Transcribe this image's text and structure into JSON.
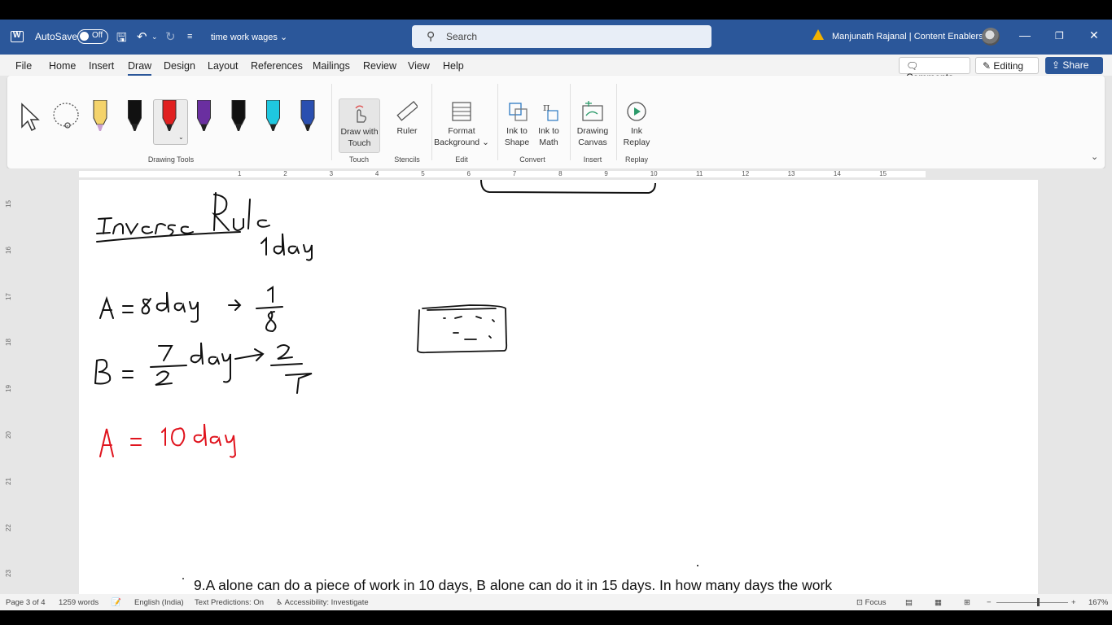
{
  "titlebar": {
    "autosave_label": "AutoSave",
    "autosave_state": "Off",
    "doc_title": "time work wages",
    "search_placeholder": "Search",
    "user_name": "Manjunath Rajanal | Content Enablers"
  },
  "tabs": [
    "File",
    "Home",
    "Insert",
    "Draw",
    "Design",
    "Layout",
    "References",
    "Mailings",
    "Review",
    "View",
    "Help"
  ],
  "active_tab": "Draw",
  "actions": {
    "comments": "Comments",
    "editing": "Editing",
    "share": "Share"
  },
  "ribbon": {
    "groups": {
      "drawing_tools": "Drawing Tools",
      "touch": "Touch",
      "stencils": "Stencils",
      "edit": "Edit",
      "convert": "Convert",
      "insert": "Insert",
      "replay": "Replay"
    },
    "buttons": {
      "draw_with_touch": [
        "Draw with",
        "Touch"
      ],
      "ruler": "Ruler",
      "format_background": [
        "Format",
        "Background"
      ],
      "ink_to_shape": [
        "Ink to",
        "Shape"
      ],
      "ink_to_math": [
        "Ink to",
        "Math"
      ],
      "drawing_canvas": [
        "Drawing",
        "Canvas"
      ],
      "ink_replay": [
        "Ink",
        "Replay"
      ]
    },
    "pen_colors": [
      "#f4d36b",
      "#111111",
      "#e02020",
      "#6a2fa0",
      "#111111",
      "#1fc8e0",
      "#2a4fb0"
    ]
  },
  "ruler_numbers": [
    "1",
    "2",
    "3",
    "4",
    "5",
    "6",
    "7",
    "8",
    "9",
    "10",
    "11",
    "12",
    "13",
    "14",
    "15"
  ],
  "vruler_numbers": [
    "15",
    "16",
    "17",
    "18",
    "19",
    "20",
    "21",
    "22",
    "23"
  ],
  "document": {
    "ink": {
      "heading": "Inverse Rule",
      "sub": "1 day",
      "line_a": "A = 8 day → 1/8",
      "line_b": "B = 7/2 day → 2/7",
      "line_red": "A = 10 day"
    },
    "question": "9.A alone can do a piece of work in 10 days, B alone can do it in 15 days. In how many days the work"
  },
  "status": {
    "page": "Page 3 of 4",
    "words": "1259 words",
    "language": "English (India)",
    "predictions": "Text Predictions: On",
    "accessibility": "Accessibility: Investigate",
    "focus": "Focus",
    "zoom": "167%"
  },
  "colors": {
    "brand": "#2b579a",
    "ink_red": "#e0141e",
    "ink_black": "#111111"
  }
}
